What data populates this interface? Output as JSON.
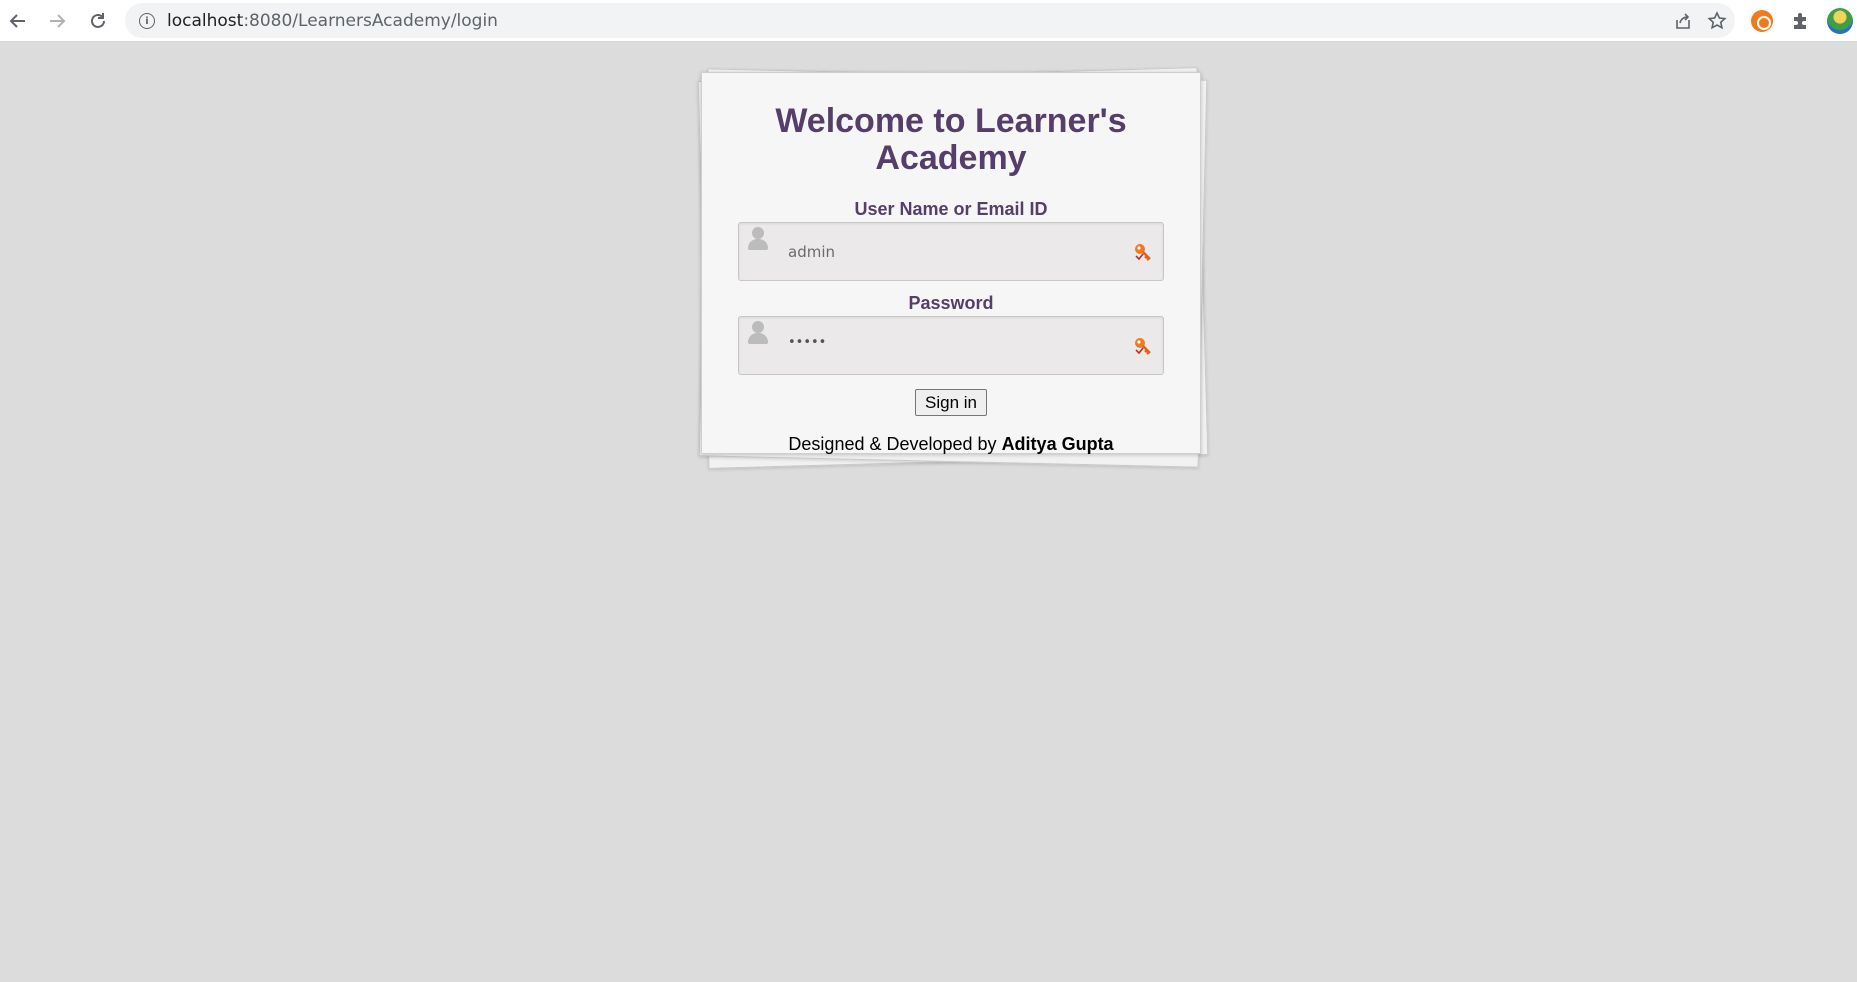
{
  "browser": {
    "url_host": "localhost",
    "url_rest": ":8080/LearnersAcademy/login",
    "icons": {
      "back": "back-arrow-icon",
      "forward": "forward-arrow-icon",
      "reload": "reload-icon",
      "site_info": "info-icon",
      "share": "share-icon",
      "bookmark": "star-icon",
      "extension": "ubuntu-extension-icon",
      "extensions_menu": "puzzle-icon",
      "profile": "profile-avatar-icon"
    }
  },
  "login": {
    "title": "Welcome to Learner's Academy",
    "username_label": "User Name or Email ID",
    "username_value": "admin",
    "password_label": "Password",
    "password_value": "•••••",
    "signin_label": "Sign in",
    "credit_prefix": "Designed & Developed by ",
    "credit_name": "Aditya Gupta"
  },
  "colors": {
    "page_background": "#dcdcdc",
    "heading": "#563e6b",
    "key_icon": "#f07a1e"
  }
}
